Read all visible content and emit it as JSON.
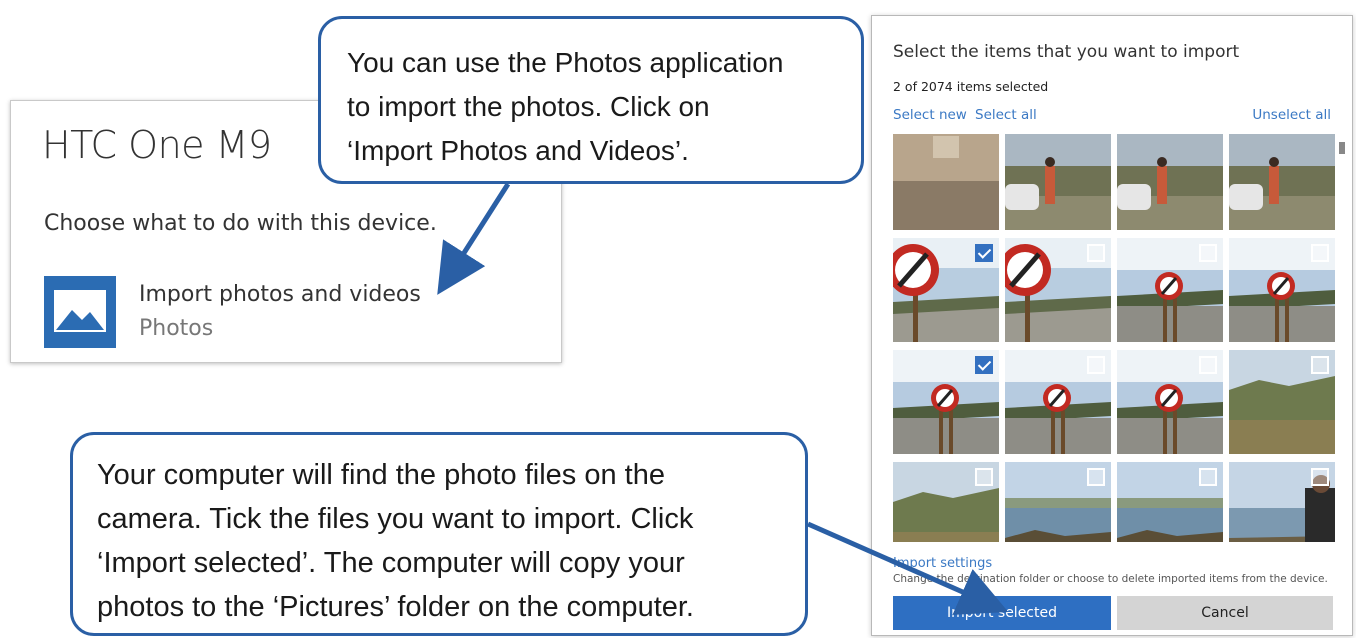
{
  "device": {
    "title": "HTC One M9",
    "prompt": "Choose what to do with this device.",
    "option_label": "Import photos and videos",
    "option_app": "Photos"
  },
  "callouts": {
    "top": [
      "You can use the Photos application",
      "to import the photos. Click on",
      "‘Import Photos and Videos’."
    ],
    "bottom": [
      "Your computer will find the photo files on the",
      "camera. Tick the files you want to import. Click",
      "‘Import selected’. The computer will copy your",
      "photos to the ‘Pictures’ folder on the computer."
    ]
  },
  "import_dialog": {
    "title": "Select the items that you want to import",
    "count": "2 of 2074 items selected",
    "select_new": "Select new",
    "select_all": "Select all",
    "unselect_all": "Unselect all",
    "settings_link": "Import settings",
    "settings_desc": "Change the destination folder or choose to delete imported items from the device.",
    "import_button": "Import selected",
    "cancel_button": "Cancel",
    "thumbnails": [
      {
        "scene": "wall",
        "checkbox": false,
        "selected": false
      },
      {
        "scene": "person-car",
        "checkbox": false,
        "selected": false
      },
      {
        "scene": "person-car",
        "checkbox": false,
        "selected": false
      },
      {
        "scene": "person-car",
        "checkbox": false,
        "selected": false
      },
      {
        "scene": "sign-big",
        "checkbox": true,
        "selected": true
      },
      {
        "scene": "sign-big",
        "checkbox": true,
        "selected": false
      },
      {
        "scene": "sign-small",
        "checkbox": true,
        "selected": false
      },
      {
        "scene": "sign-small",
        "checkbox": true,
        "selected": false
      },
      {
        "scene": "sign-small",
        "checkbox": true,
        "selected": true
      },
      {
        "scene": "sign-small",
        "checkbox": true,
        "selected": false
      },
      {
        "scene": "sign-small",
        "checkbox": true,
        "selected": false
      },
      {
        "scene": "landscape",
        "checkbox": true,
        "selected": false
      },
      {
        "scene": "landscape",
        "checkbox": true,
        "selected": false
      },
      {
        "scene": "coast",
        "checkbox": true,
        "selected": false
      },
      {
        "scene": "coast",
        "checkbox": true,
        "selected": false
      },
      {
        "scene": "coast-person",
        "checkbox": true,
        "selected": false
      }
    ]
  },
  "colors": {
    "accent": "#2e6fc2",
    "callout_border": "#2a5fa5",
    "link": "#3b79c4"
  }
}
